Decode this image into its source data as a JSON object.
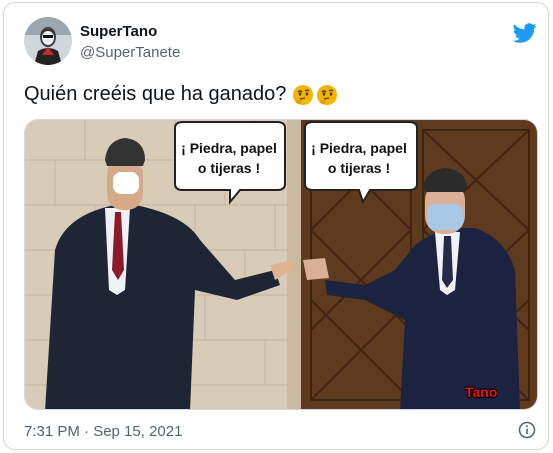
{
  "tweet": {
    "author_name": "SuperTano",
    "author_handle": "@SuperTanete",
    "text": "Quién creéis que ha ganado?",
    "emojis": [
      "thinking-face-emoji",
      "thinking-face-emoji"
    ],
    "timestamp": "7:31 PM · Sep 15, 2021"
  },
  "media": {
    "bubble_left": "¡ Piedra, papel o tijeras !",
    "bubble_right": "¡ Piedra, papel o tijeras !",
    "watermark": "Tano"
  },
  "colors": {
    "twitter_blue": "#1d9bf0",
    "text_primary": "#0f1419",
    "text_secondary": "#536471",
    "border": "#cfd9de",
    "watermark_red": "#e11111"
  },
  "icons": {
    "brand": "twitter-bird-icon",
    "info": "info-icon"
  }
}
